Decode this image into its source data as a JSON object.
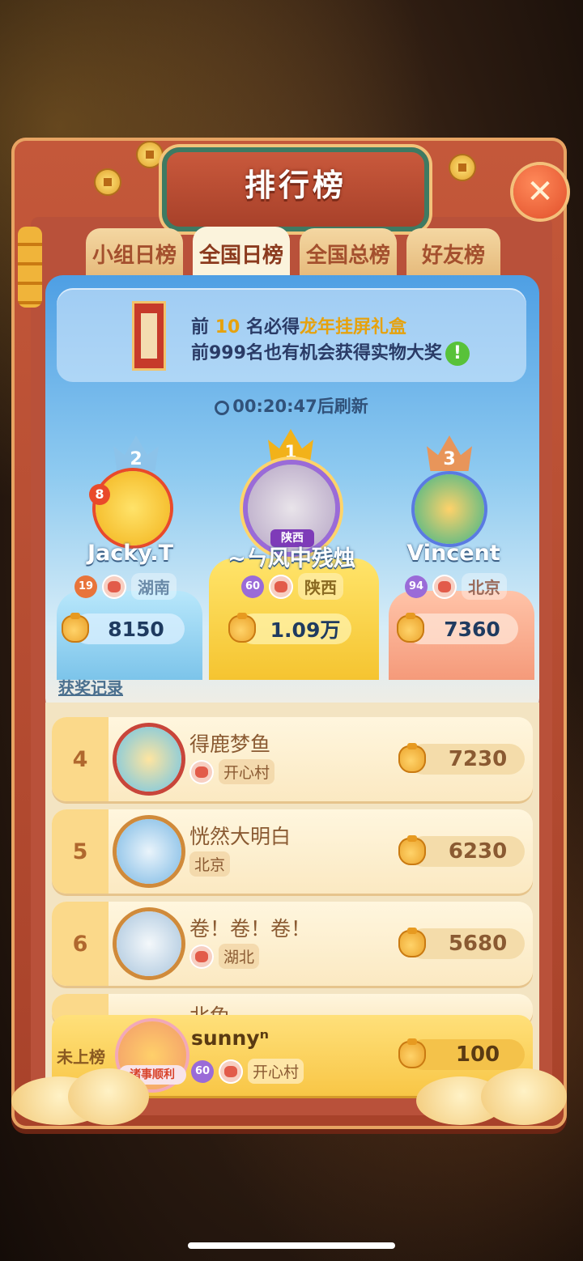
{
  "title": "排行榜",
  "close_icon": "close-icon",
  "tabs": [
    {
      "label": "小组日榜",
      "active": false
    },
    {
      "label": "全国日榜",
      "active": true
    },
    {
      "label": "全国总榜",
      "active": false
    },
    {
      "label": "好友榜",
      "active": false
    }
  ],
  "banner": {
    "line1_prefix": "前",
    "line1_num": "10",
    "line1_mid": "名必得",
    "line1_prize": "龙年挂屏礼盒",
    "line2": "前999名也有机会获得实物大奖",
    "info_icon": "!"
  },
  "timer": {
    "text": "00:20:47后刷新"
  },
  "podium": [
    {
      "rank": "2",
      "badge": "8",
      "name": "Jacky.T",
      "level": "19",
      "region": "湖南",
      "score": "8150",
      "color": "#9fd0f2"
    },
    {
      "rank": "1",
      "badge": "陕西",
      "name": "~ㄣ风中残烛",
      "level": "60",
      "region": "陕西",
      "score": "1.09万",
      "color": "#ffd43a"
    },
    {
      "rank": "3",
      "name": "Vincent",
      "level": "94",
      "region": "北京",
      "score": "7360",
      "color": "#f0a37a"
    }
  ],
  "record_link": "获奖记录",
  "list": [
    {
      "rank": "4",
      "name": "得鹿梦鱼",
      "tag": "开心村",
      "score": "7230"
    },
    {
      "rank": "5",
      "name": "恍然大明白",
      "tag": "北京",
      "score": "6230"
    },
    {
      "rank": "6",
      "name": "卷！卷！卷！",
      "tag": "湖北",
      "score": "5680"
    },
    {
      "rank": "",
      "name": "北兔",
      "tag": "",
      "score": ""
    }
  ],
  "me": {
    "rank": "未上榜",
    "name": "sunnyⁿ",
    "level": "60",
    "tag": "开心村",
    "score": "100",
    "avatar_text": "诸事顺利"
  },
  "colors": {
    "frame": "#b9513a",
    "gold": "#f8c646",
    "accent": "#e6a20e"
  }
}
